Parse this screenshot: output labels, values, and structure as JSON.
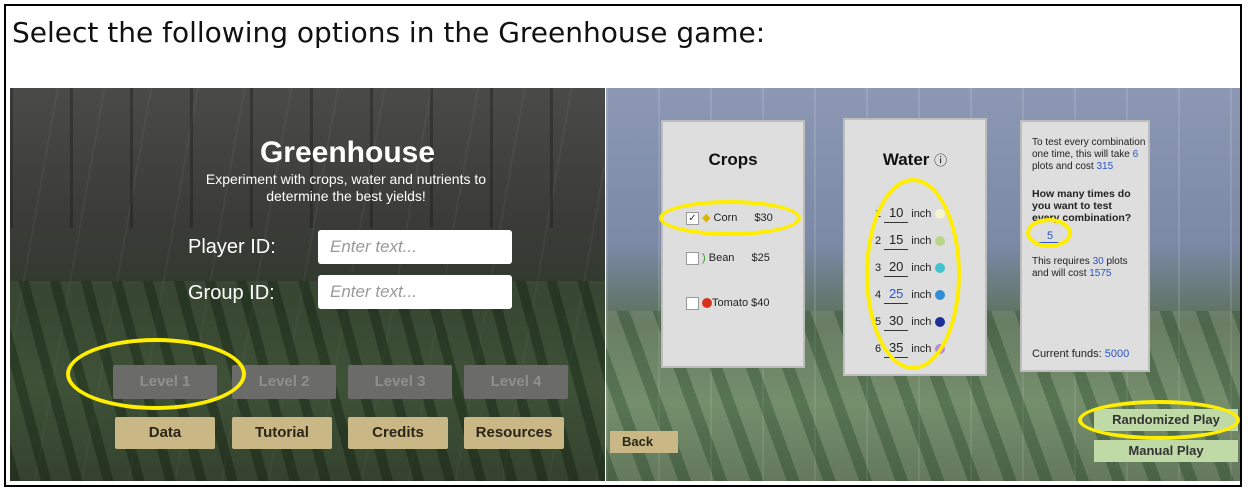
{
  "instruction": "Select the following options in the Greenhouse game:",
  "menu": {
    "title": "Greenhouse",
    "subtitle": "Experiment with crops, water and nutrients to determine the best yields!",
    "player_label": "Player ID:",
    "player_placeholder": "Enter text...",
    "group_label": "Group ID:",
    "group_placeholder": "Enter text...",
    "levels": [
      "Level 1",
      "Level 2",
      "Level 3",
      "Level 4"
    ],
    "buttons": [
      "Data",
      "Tutorial",
      "Credits",
      "Resources"
    ]
  },
  "setup": {
    "crops_title": "Crops",
    "crops": [
      {
        "name": "Corn",
        "price": "$30",
        "checked": true,
        "check": "✓"
      },
      {
        "name": "Bean",
        "price": "$25",
        "checked": false,
        "check": ""
      },
      {
        "name": "Tomato",
        "price": "$40",
        "checked": false,
        "check": ""
      }
    ],
    "water_title": "Water",
    "water_info_icon": "ⓘ",
    "water_unit": "inch",
    "water_levels": [
      {
        "index": "1",
        "value": "10",
        "color": "#f4f4d0"
      },
      {
        "index": "2",
        "value": "15",
        "color": "#b9d58a"
      },
      {
        "index": "3",
        "value": "20",
        "color": "#41c2cf"
      },
      {
        "index": "4",
        "value": "25",
        "color": "#2f8fd6"
      },
      {
        "index": "5",
        "value": "30",
        "color": "#1e2f9a"
      },
      {
        "index": "6",
        "value": "35",
        "color": "#b98ad8"
      }
    ],
    "summary": {
      "line1": "To test every combination",
      "line2_pre": "one time, this will take",
      "plots": "6",
      "line3_pre": "plots and cost",
      "cost": "315",
      "question1": "How many times do",
      "question2": "you  want to test",
      "question3": "every combination?",
      "repeats": "5",
      "req_pre": "This requires",
      "req_plots": "30",
      "req_mid": "plots",
      "req_line2_pre": "and will cost",
      "req_cost": "1575",
      "funds_label": "Current funds:",
      "funds": "5000"
    },
    "back": "Back",
    "randomized": "Randomized Play",
    "manual": "Manual Play"
  }
}
